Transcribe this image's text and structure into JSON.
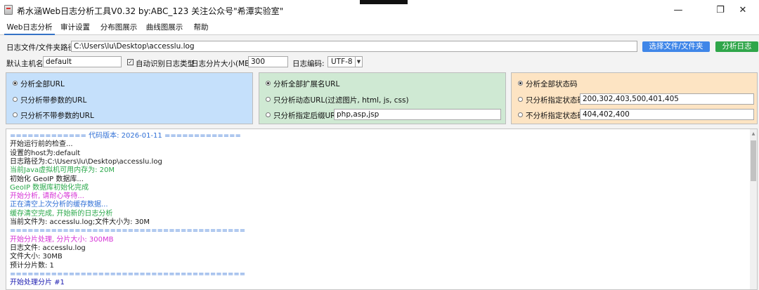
{
  "window": {
    "title": "希水涵Web日志分析工具V0.32 by:ABC_123 关注公众号\"希潭实验室\"",
    "minimize_glyph": "—",
    "maximize_glyph": "❐",
    "close_glyph": "✕"
  },
  "menu": {
    "items": [
      "Web日志分析",
      "审计设置",
      "分布图展示",
      "曲线图展示",
      "帮助"
    ]
  },
  "form": {
    "path_label": "日志文件/文件夹路径:",
    "path_value": "C:\\Users\\lu\\Desktop\\accesslu.log",
    "choose_button": "选择文件/文件夹",
    "analyze_button": "分析日志",
    "host_label": "默认主机名:",
    "host_value": "default",
    "auto_detect_label": "自动识别日志类型",
    "auto_detect_checked": "✓",
    "slice_label": "日志分片大小(MB):",
    "slice_value": "300",
    "encoding_label": "日志编码:",
    "encoding_value": "UTF-8",
    "encoding_arrow": "▼"
  },
  "panels": {
    "url": {
      "options": [
        "分析全部URL",
        "只分析带参数的URL",
        "只分析不带参数的URL"
      ]
    },
    "ext": {
      "options": [
        "分析全部扩展名URL",
        "只分析动态URL(过滤图片, html, js, css)",
        "只分析指定后缀URL"
      ],
      "suffix_value": "php,asp,jsp"
    },
    "status": {
      "options": [
        "分析全部状态码",
        "只分析指定状态码",
        "不分析指定状态码"
      ],
      "include_value": "200,302,403,500,401,405",
      "exclude_value": "404,402,400"
    }
  },
  "colors": {
    "blue_text": "#2f6fd6",
    "green_text": "#2aa84a",
    "magenta_text": "#d632d6",
    "black_text": "#1a1a1a",
    "navy_text": "#1a1ab0"
  },
  "log": [
    {
      "text": "============= 代码版本: 2026-01-11 =============",
      "color": "#2f6fd6"
    },
    {
      "text": "开始运行前的检查...",
      "color": "#1a1a1a"
    },
    {
      "text": "设置的host为:default",
      "color": "#1a1a1a"
    },
    {
      "text": "日志路径为:C:\\Users\\lu\\Desktop\\accesslu.log",
      "color": "#1a1a1a"
    },
    {
      "text": "当前Java虚拟机可用内存为: 20M",
      "color": "#2aa84a"
    },
    {
      "text": "初始化 GeoIP 数据库...",
      "color": "#1a1a1a"
    },
    {
      "text": "GeoIP 数据库初始化完成",
      "color": "#2aa84a"
    },
    {
      "text": "开始分析, 请耐心等待...",
      "color": "#d632d6"
    },
    {
      "text": "正在清空上次分析的缓存数据...",
      "color": "#2f6fd6"
    },
    {
      "text": "缓存清空完成, 开始新的日志分析",
      "color": "#2aa84a"
    },
    {
      "text": "当前文件为: accesslu.log;文件大小为: 30M",
      "color": "#1a1a1a"
    },
    {
      "text": "========================================",
      "color": "#2f6fd6"
    },
    {
      "text": "开始分片处理, 分片大小: 300MB",
      "color": "#d632d6"
    },
    {
      "text": "日志文件: accesslu.log",
      "color": "#1a1a1a"
    },
    {
      "text": "文件大小: 30MB",
      "color": "#1a1a1a"
    },
    {
      "text": "预计分片数: 1",
      "color": "#1a1a1a"
    },
    {
      "text": "========================================",
      "color": "#2f6fd6"
    },
    {
      "text": "开始处理分片 #1",
      "color": "#1a1ab0"
    }
  ]
}
